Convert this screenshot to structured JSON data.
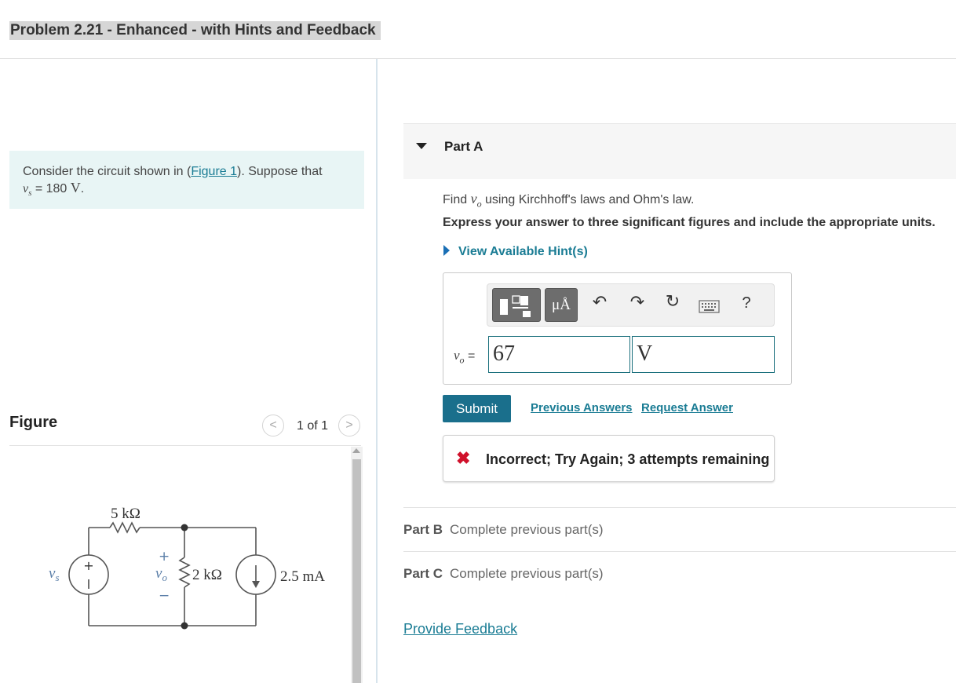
{
  "header": {
    "title": "Problem 2.21 - Enhanced - with Hints and Feedback"
  },
  "problem": {
    "text_before": "Consider the circuit shown in (",
    "figure_link": "Figure 1",
    "text_after": "). Suppose that",
    "var": "v",
    "var_sub": "s",
    "value_text": " = 180 ",
    "unit": "V",
    "period": "."
  },
  "figure": {
    "title": "Figure",
    "pager": "1 of 1",
    "prev_icon": "chevron-left-icon",
    "next_icon": "chevron-right-icon",
    "circuit": {
      "r1_label": "5 kΩ",
      "r2_label": "2 kΩ",
      "source_label": "v",
      "source_sub": "s",
      "current_label": "2.5 mA",
      "vo_label": "v",
      "vo_sub": "o",
      "plus": "+",
      "minus": "−"
    }
  },
  "partA": {
    "label": "Part A",
    "find_before": "Find ",
    "find_var": "v",
    "find_sub": "o",
    "find_after": " using Kirchhoff's laws and Ohm's law.",
    "express": "Express your answer to three significant figures and include the appropriate units.",
    "hint": "View Available Hint(s)",
    "toolbar": {
      "units_label": "μÅ",
      "help": "?"
    },
    "answer_var": "v",
    "answer_sub": "o",
    "answer_eq": " =",
    "value": "67",
    "unit": "V",
    "submit": "Submit",
    "previous_answers": "Previous Answers",
    "request_answer": "Request Answer",
    "feedback": "Incorrect; Try Again; 3 attempts remaining",
    "feedback_icon": "✖"
  },
  "partB": {
    "name": "Part B",
    "status": "Complete previous part(s)"
  },
  "partC": {
    "name": "Part C",
    "status": "Complete previous part(s)"
  },
  "provide_feedback": "Provide Feedback",
  "colors": {
    "accent": "#1a7c94",
    "submit_bg": "#1a6f8c",
    "error": "#d0112b",
    "problem_bg": "#e8f5f5"
  }
}
